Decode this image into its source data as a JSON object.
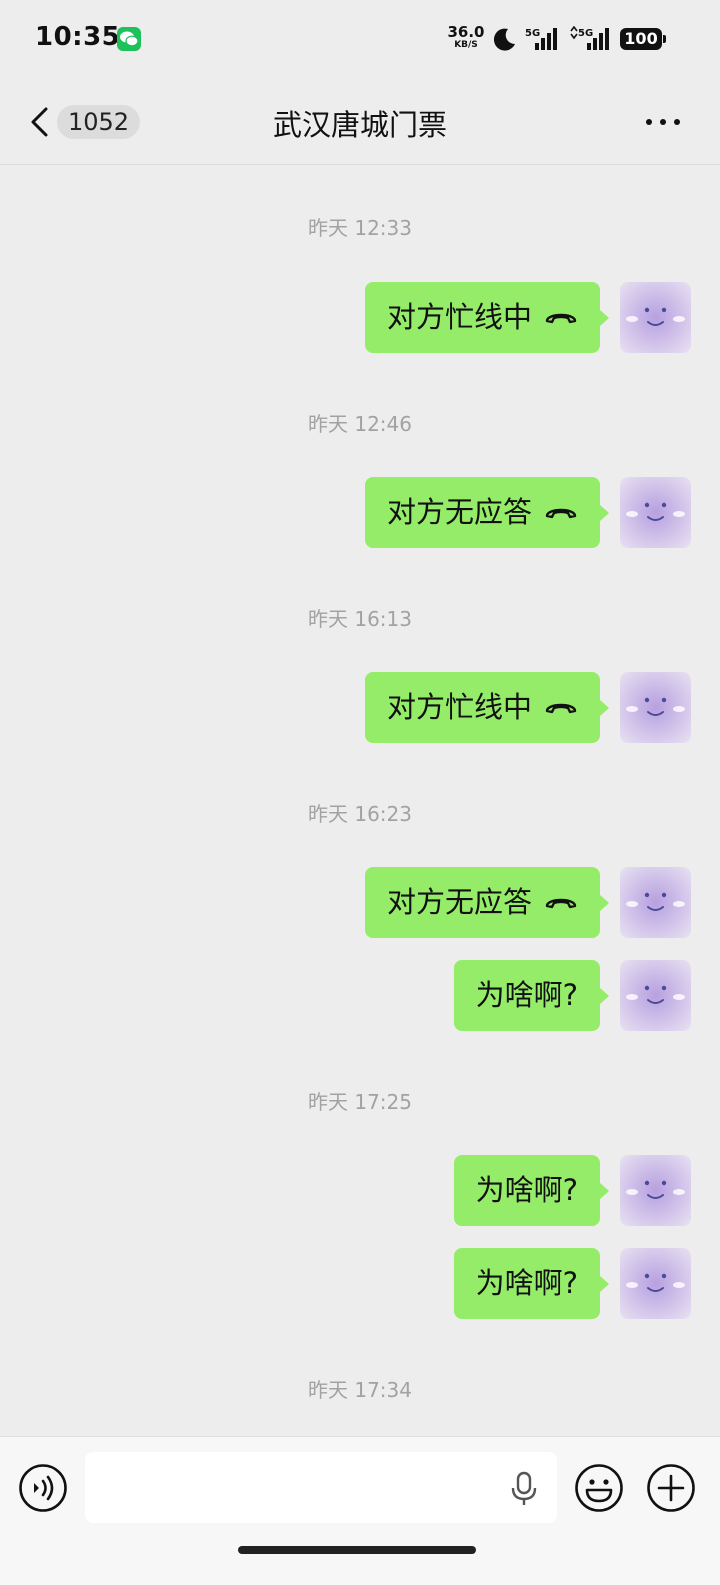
{
  "status_bar": {
    "time": "10:35",
    "net_speed_value": "36.0",
    "net_speed_unit": "KB/S",
    "battery": "100",
    "network_1": "5G",
    "network_2": "5G"
  },
  "nav": {
    "unread_count": "1052",
    "title": "武汉唐城门票",
    "more_icon": "more-dots-icon",
    "back_icon": "chevron-left-icon"
  },
  "messages": [
    {
      "time": "昨天 12:33",
      "text": "对方忙线中",
      "call": true
    },
    {
      "time": "昨天 12:46",
      "text": "对方无应答",
      "call": true
    },
    {
      "time": "昨天 16:13",
      "text": "对方忙线中",
      "call": true
    },
    {
      "time": "昨天 16:23",
      "text": "对方无应答",
      "call": true
    },
    {
      "text": "为啥啊?"
    },
    {
      "time": "昨天 17:25",
      "text": "为啥啊?"
    },
    {
      "text": "为啥啊?"
    },
    {
      "time": "昨天 17:34"
    }
  ],
  "input_bar": {
    "placeholder": "",
    "icons": [
      "voice-icon",
      "mic-icon",
      "emoji-icon",
      "plus-icon"
    ]
  },
  "colors": {
    "bubble": "#95ec69",
    "background": "#ededed",
    "wechat_green": "#1fc15a"
  }
}
